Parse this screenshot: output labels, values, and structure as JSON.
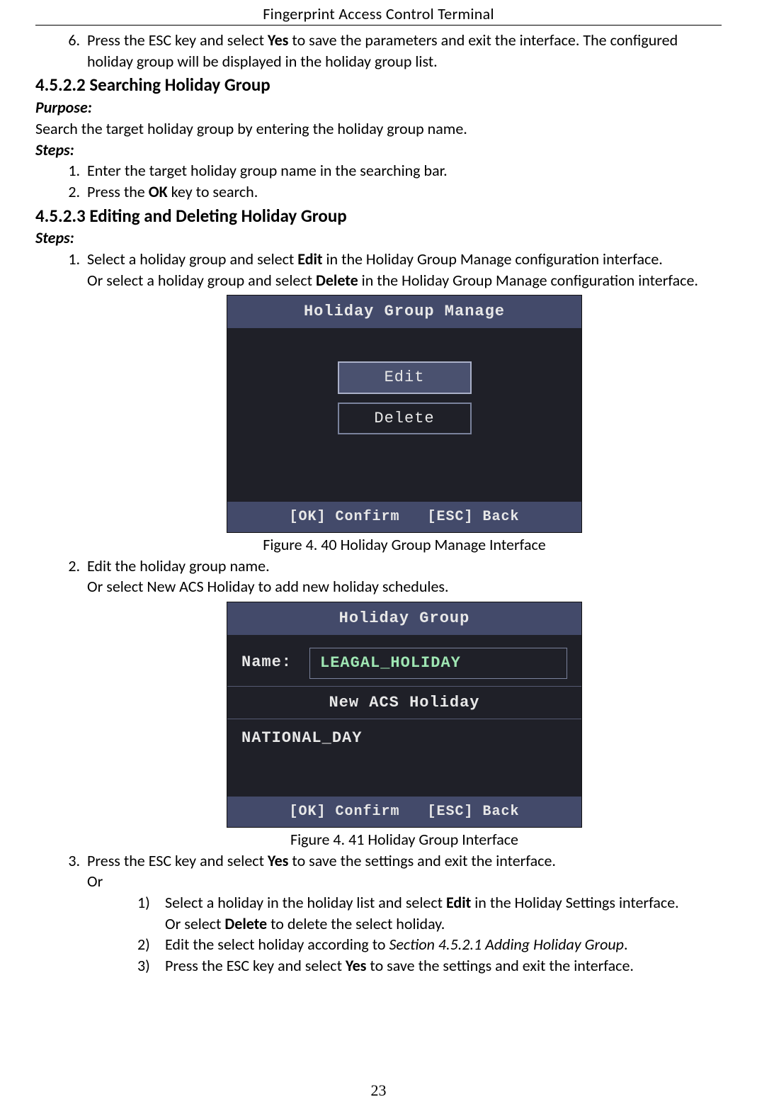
{
  "header": "Fingerprint Access Control Terminal",
  "intro_list": {
    "start": 6,
    "item": {
      "prefix": "Press the ESC key and select ",
      "bold1": "Yes",
      "suffix": " to save the parameters and exit the interface. The configured holiday group will be displayed in the holiday group list."
    }
  },
  "sec_search": {
    "heading": "4.5.2.2 Searching Holiday Group",
    "purpose_label": "Purpose:",
    "purpose_text": "Search the target holiday group by entering the holiday group name.",
    "steps_label": "Steps:",
    "steps": [
      "Enter the target holiday group name in the searching bar.",
      {
        "prefix": "Press the ",
        "bold": "OK",
        "suffix": " key to search."
      }
    ]
  },
  "sec_edit": {
    "heading": "4.5.2.3 Editing and Deleting Holiday Group",
    "steps_label": "Steps:",
    "step1": {
      "line1_prefix": "Select a holiday group and select ",
      "line1_bold": "Edit",
      "line1_suffix": " in the Holiday Group Manage configuration interface.",
      "line2_prefix": "Or select a holiday group and select ",
      "line2_bold": "Delete",
      "line2_suffix": " in the Holiday Group Manage configuration interface."
    },
    "fig40": {
      "title": "Holiday Group Manage",
      "btn_edit": "Edit",
      "btn_delete": "Delete",
      "footer_ok": "[OK] Confirm",
      "footer_esc": "[ESC] Back",
      "caption_prefix": "Figure 4. 40",
      "caption_text": " Holiday Group Manage Interface"
    },
    "step2": {
      "line1": "Edit the holiday group name.",
      "line2": "Or select New ACS Holiday to add new holiday schedules."
    },
    "fig41": {
      "title": "Holiday Group",
      "name_label": "Name:",
      "name_value": "LEAGAL_HOLIDAY",
      "new_row": "New ACS Holiday",
      "item1": "NATIONAL_DAY",
      "footer_ok": "[OK] Confirm",
      "footer_esc": "[ESC] Back",
      "caption_prefix": "Figure 4. 41",
      "caption_text": " Holiday Group Interface"
    },
    "step3": {
      "line1_prefix": "Press the ESC key and select ",
      "line1_bold": "Yes",
      "line1_suffix": " to save the settings and exit the interface.",
      "or": "Or",
      "sub": [
        {
          "p1": "Select a holiday in the holiday list and select ",
          "b1": "Edit",
          "p2": " in the Holiday Settings interface.",
          "line2_prefix": "Or select ",
          "line2_bold": "Delete",
          "line2_suffix": " to delete the select holiday."
        },
        {
          "p1": "Edit the select holiday according to ",
          "i1": "Section 4.5.2.1 Adding Holiday Group",
          "p2": "."
        },
        {
          "p1": "Press the ESC key and select ",
          "b1": "Yes",
          "p2": " to save the settings and exit the interface."
        }
      ]
    }
  },
  "page_number": "23"
}
